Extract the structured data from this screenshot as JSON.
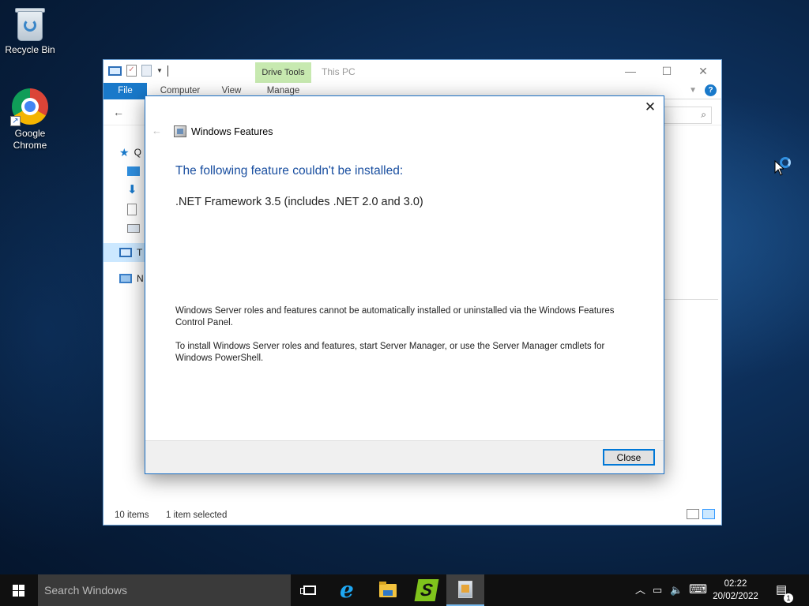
{
  "desktop": {
    "icons": [
      {
        "label": "Recycle Bin"
      },
      {
        "label": "Google Chrome"
      }
    ]
  },
  "explorer": {
    "title": "This PC",
    "contextual_tab_group": "Drive Tools",
    "ribbon_tabs": [
      "File",
      "Computer",
      "View",
      "Manage"
    ],
    "nav_items": [
      "Q",
      "T",
      "N"
    ],
    "status": {
      "items": "10 items",
      "selected": "1 item selected"
    },
    "window_controls": {
      "minimize": "—",
      "maximize": "☐",
      "close": "✕"
    }
  },
  "dialog": {
    "app_title": "Windows Features",
    "heading": "The following feature couldn't be installed:",
    "feature": ".NET Framework 3.5 (includes .NET 2.0 and 3.0)",
    "paragraph1": "Windows Server roles and features cannot be automatically installed or uninstalled via the Windows Features Control Panel.",
    "paragraph2": "To install Windows Server roles and features, start Server Manager, or use the Server Manager cmdlets for Windows PowerShell.",
    "close_button": "Close"
  },
  "taskbar": {
    "search_placeholder": "Search Windows",
    "time": "02:22",
    "date": "20/02/2022",
    "notification_count": "1"
  },
  "colors": {
    "accent": "#1979ca",
    "dialog_heading": "#1a4fa0",
    "drive_tools": "#c7e9b0"
  }
}
